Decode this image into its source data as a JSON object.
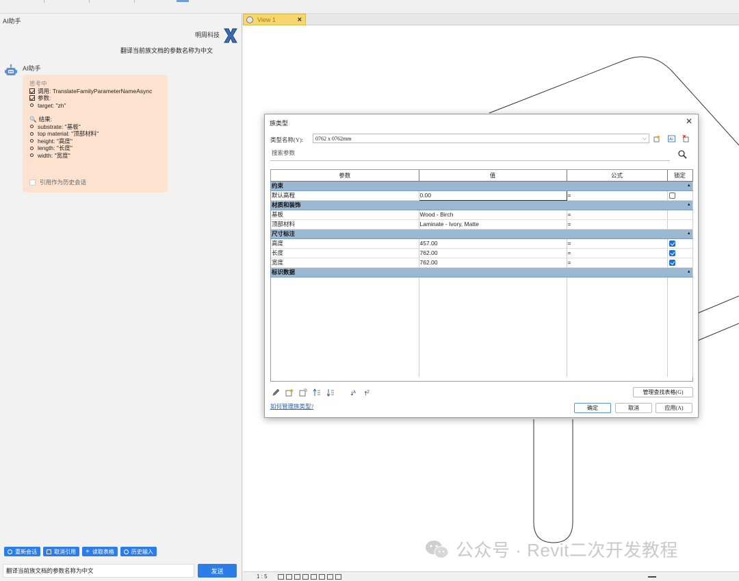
{
  "left_panel": {
    "title": "AI助手",
    "user_name": "明周科技",
    "user_message": "翻译当前族文档的参数名称为中文",
    "ai_name": "AI助手",
    "thinking_label": "思考中",
    "call_label": "调用: TranslateFamilyParameterNameAsync",
    "params_label": "参数:",
    "param_target": "target: \"zh\"",
    "result_label": "结果:",
    "results": [
      "substrate: \"基板\"",
      "top material: \"顶部材料\"",
      "height: \"高度\"",
      "length: \"长度\"",
      "width: \"宽度\""
    ],
    "cite_history_label": "引用作为历史会话",
    "buttons": {
      "new_session": "重新会话",
      "cancel_cite": "取消引用",
      "read_table": "读取表格",
      "history_input": "历史输入"
    },
    "input_value": "翻译当前族文档的参数名称为中文",
    "send_label": "发送"
  },
  "view": {
    "tab_label": "View 1",
    "scale": "1 : 5",
    "watermark": "公众号 · Revit二次开发教程"
  },
  "dialog": {
    "title": "族类型",
    "type_name_label": "类型名称(Y):",
    "type_name_value": "0762 x 0762mm",
    "search_placeholder": "搜索参数",
    "columns": [
      "参数",
      "值",
      "公式",
      "锁定"
    ],
    "groups": {
      "constraints": "约束",
      "materials": "材质和装饰",
      "dimensions": "尺寸标注",
      "identity": "标识数据"
    },
    "rows": {
      "default_elevation": {
        "name": "默认高程",
        "value": "0.00",
        "formula": "=",
        "locked": false
      },
      "substrate": {
        "name": "基板",
        "value": "Wood - Birch",
        "formula": "="
      },
      "top_material": {
        "name": "顶部材料",
        "value": "Laminate - Ivory, Matte",
        "formula": "="
      },
      "height": {
        "name": "高度",
        "value": "457.00",
        "formula": "=",
        "locked": true
      },
      "length": {
        "name": "长度",
        "value": "762.00",
        "formula": "=",
        "locked": true
      },
      "width": {
        "name": "宽度",
        "value": "762.00",
        "formula": "=",
        "locked": true
      }
    },
    "manage_lookup_label": "管理查找表格(G)",
    "help_link": "如何管理族类型?",
    "ok_label": "确定",
    "cancel_label": "取消",
    "apply_label": "应用(A)"
  },
  "colors": {
    "accent_blue": "#2d7de8",
    "ai_bubble": "#fde3cf",
    "group_header": "#9bb8d3",
    "view_tab": "#f5d76e"
  }
}
